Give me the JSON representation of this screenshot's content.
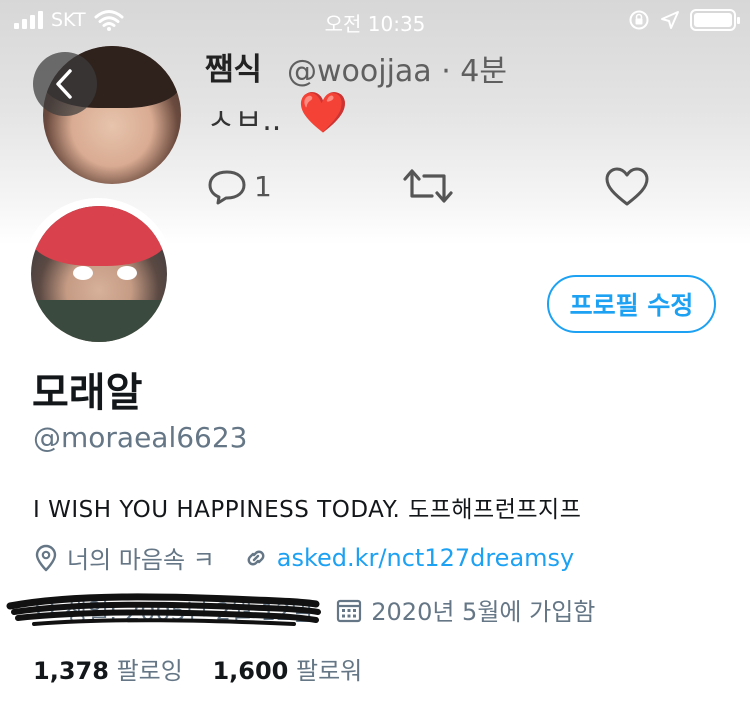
{
  "status_bar": {
    "carrier": "SKT",
    "time": "오전 10:35",
    "icons": [
      "signal-icon",
      "wifi-icon",
      "orientation-lock-icon",
      "location-arrow-icon",
      "battery-icon"
    ]
  },
  "header_tweet": {
    "name": "쨈식",
    "handle": "@woojjaa · 4분",
    "text": "ㅅㅂ..",
    "emoji": "❤️",
    "reply_count": "1"
  },
  "profile": {
    "name": "모래알",
    "handle": "@moraeal6623",
    "bio": "I WISH YOU HAPPINESS TODAY. 도프해프런프지프",
    "location": "너의 마음속 ㅋ",
    "link": "asked.kr/nct127dreamsy",
    "birthday": "생일: 2005년 2월 12일",
    "joined": "2020년 5월에 가입함",
    "following_count": "1,378",
    "following_label": "팔로잉",
    "followers_count": "1,600",
    "followers_label": "팔로워",
    "edit_button": "프로필 수정"
  },
  "colors": {
    "accent": "#1da1f2",
    "secondary_text": "#657786",
    "heart": "#e0243a"
  }
}
